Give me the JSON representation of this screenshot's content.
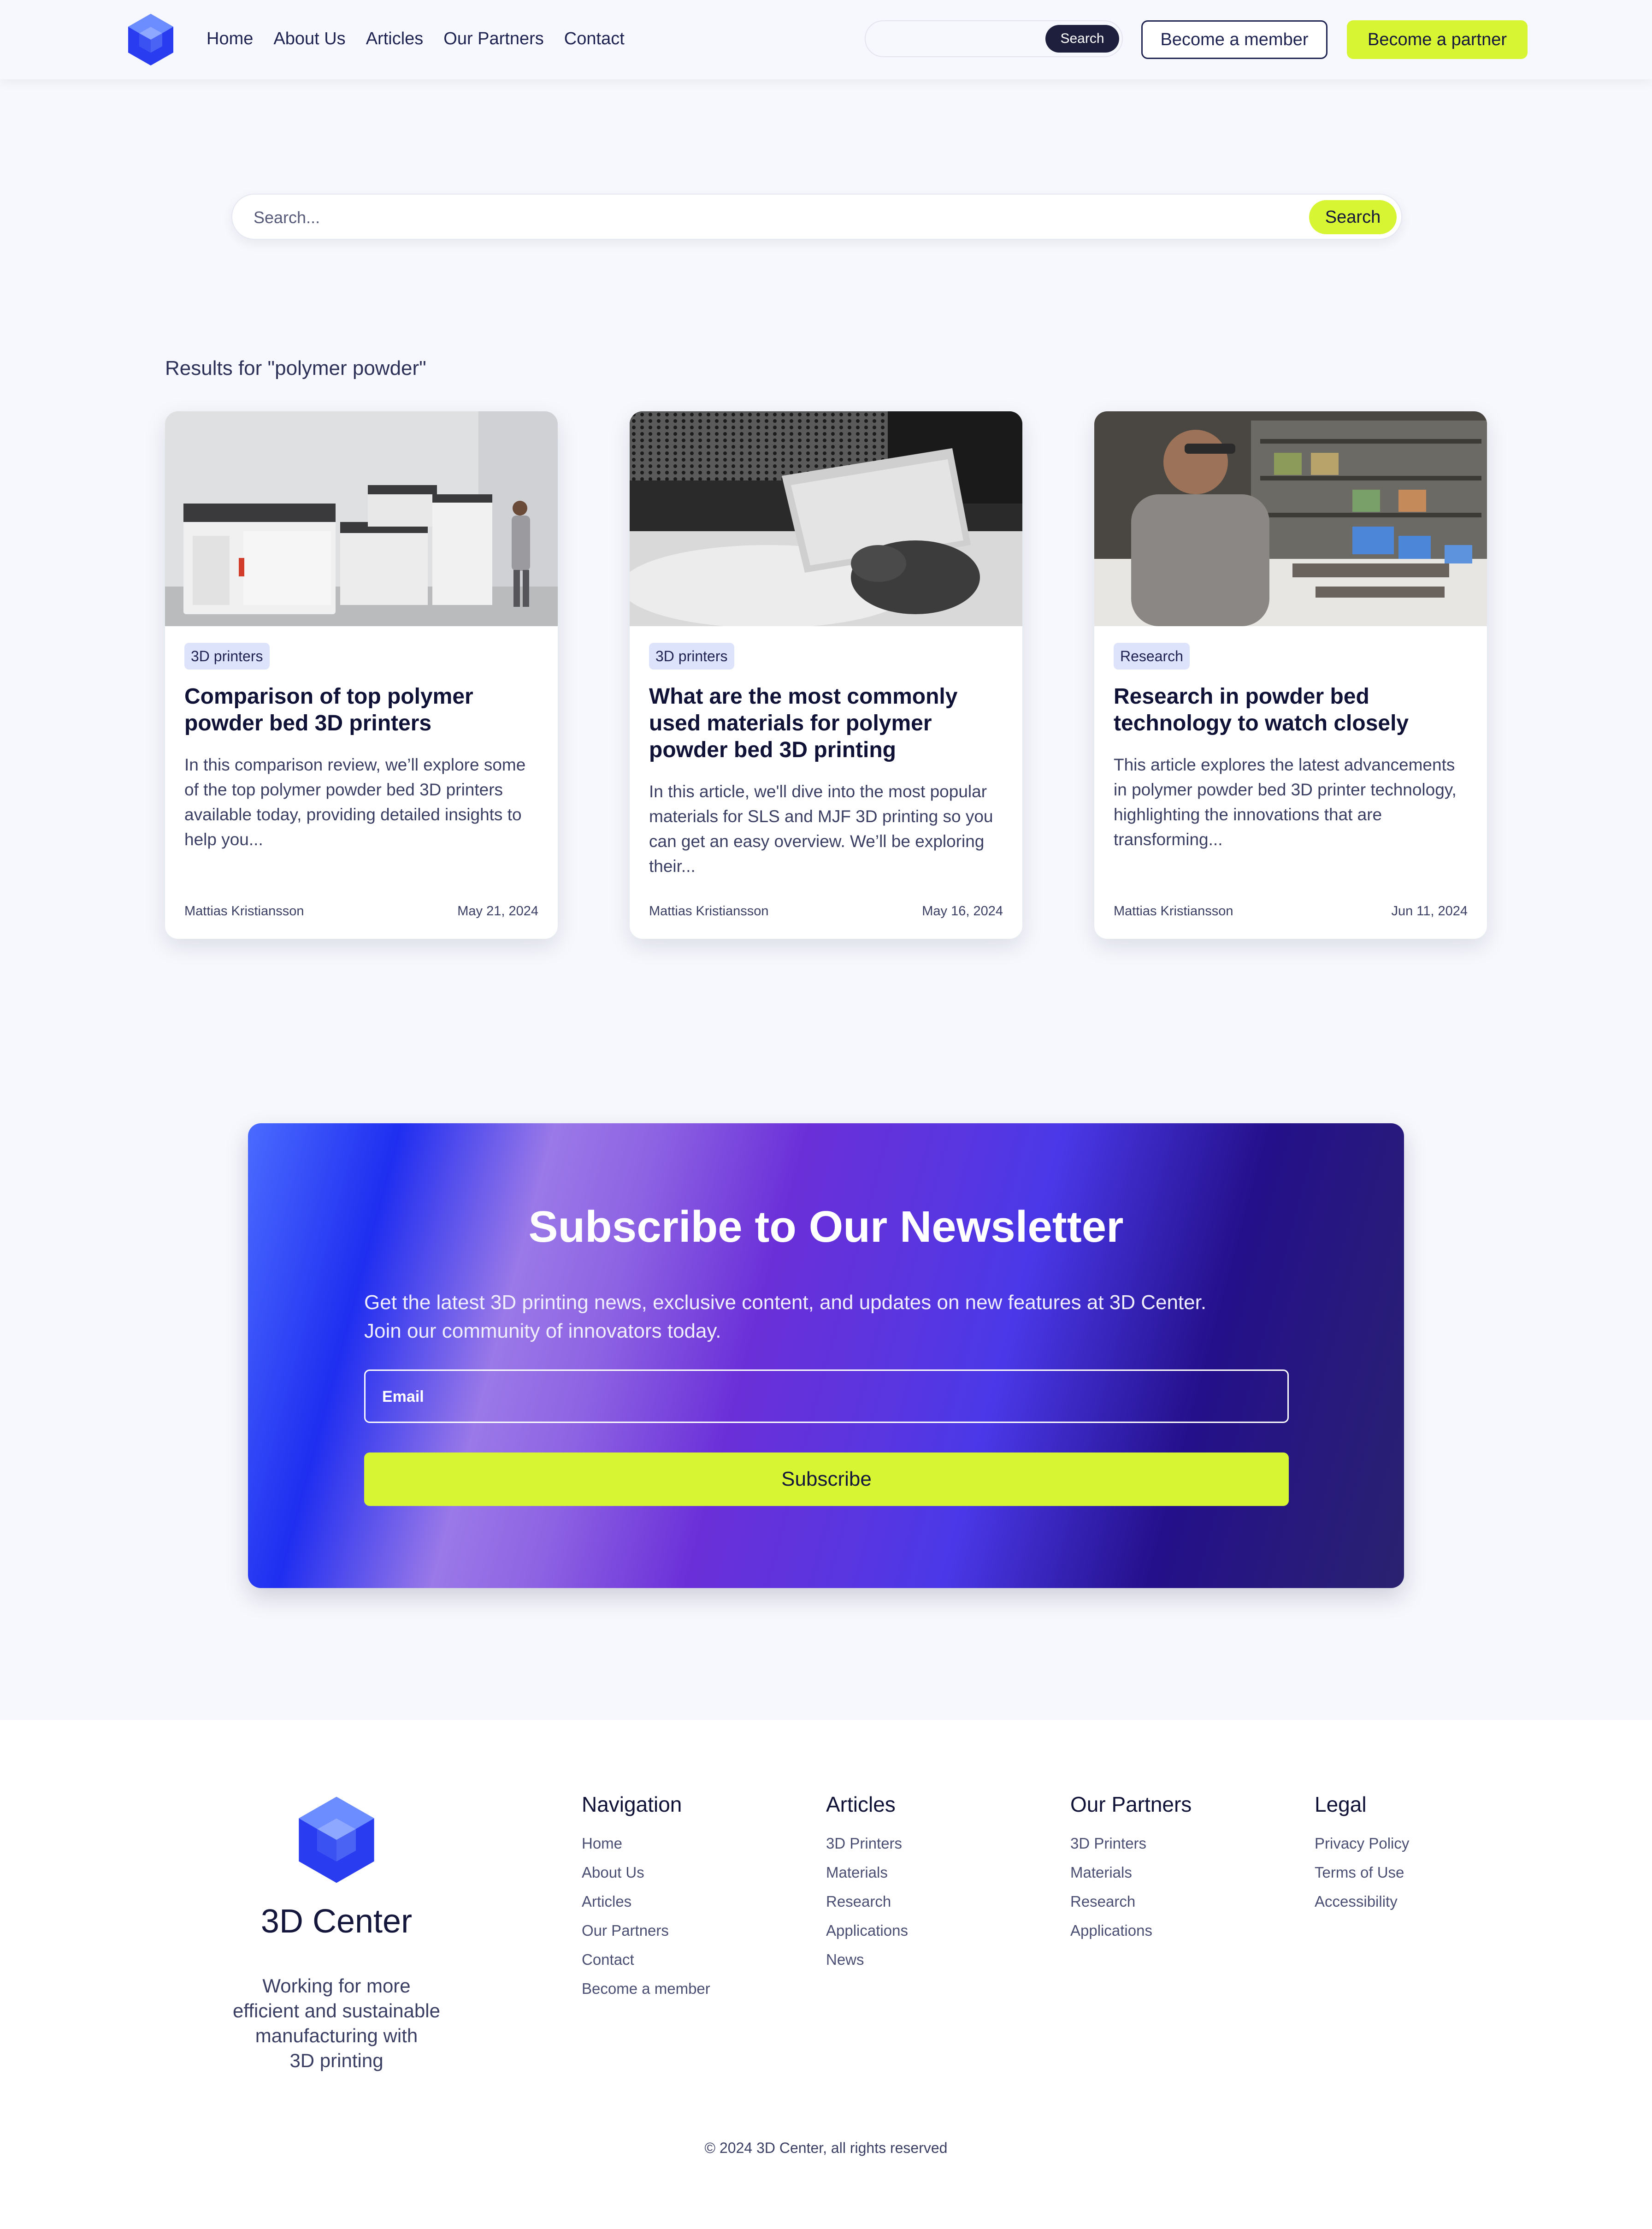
{
  "header": {
    "nav": [
      "Home",
      "About Us",
      "Articles",
      "Our Partners",
      "Contact"
    ],
    "search_button": "Search",
    "search_value": "",
    "become_member": "Become a member",
    "become_partner": "Become a partner"
  },
  "search": {
    "placeholder": "Search...",
    "button": "Search"
  },
  "results": {
    "heading": "Results for \"polymer powder\"",
    "cards": [
      {
        "tag": "3D printers",
        "title": "Comparison of top polymer powder bed 3D printers",
        "excerpt": "In this comparison review, we’ll explore some of the top polymer powder bed 3D printers available today, providing detailed insights to help you...",
        "author": "Mattias Kristiansson",
        "date": "May 21, 2024"
      },
      {
        "tag": "3D printers",
        "title": "What are the most commonly used materials for polymer powder bed 3D printing",
        "excerpt": "In this article, we'll dive into the most popular materials for SLS and MJF 3D printing so you can get an easy overview. We’ll be exploring their...",
        "author": "Mattias Kristiansson",
        "date": "May 16, 2024"
      },
      {
        "tag": "Research",
        "title": "Research in powder bed technology to watch closely",
        "excerpt": "This article explores the latest advancements in polymer powder bed 3D printer technology, highlighting the innovations that are transforming...",
        "author": "Mattias Kristiansson",
        "date": "Jun 11, 2024"
      }
    ]
  },
  "newsletter": {
    "title": "Subscribe to Our Newsletter",
    "description": "Get the latest 3D printing news, exclusive content, and updates on new features at 3D Center. Join our community of innovators today.",
    "email_placeholder": "Email",
    "button": "Subscribe"
  },
  "footer": {
    "brand": "3D Center",
    "tagline_lines": [
      "Working for more",
      "efficient and sustainable",
      "manufacturing with",
      "3D printing"
    ],
    "columns": [
      {
        "title": "Navigation",
        "links": [
          "Home",
          "About Us",
          "Articles",
          "Our Partners",
          "Contact",
          "Become a member"
        ]
      },
      {
        "title": "Articles",
        "links": [
          "3D Printers",
          "Materials",
          "Research",
          "Applications",
          "News"
        ]
      },
      {
        "title": "Our Partners",
        "links": [
          "3D Printers",
          "Materials",
          "Research",
          "Applications"
        ]
      },
      {
        "title": "Legal",
        "links": [
          "Privacy Policy",
          "Terms of Use",
          "Accessibility"
        ]
      }
    ],
    "copyright": "© 2024 3D Center, all rights reserved"
  },
  "colors": {
    "accent": "#d7f532",
    "navy": "#14173b",
    "brand_blue": "#2a3cf0"
  },
  "icons": [
    "cube-logo-icon"
  ]
}
